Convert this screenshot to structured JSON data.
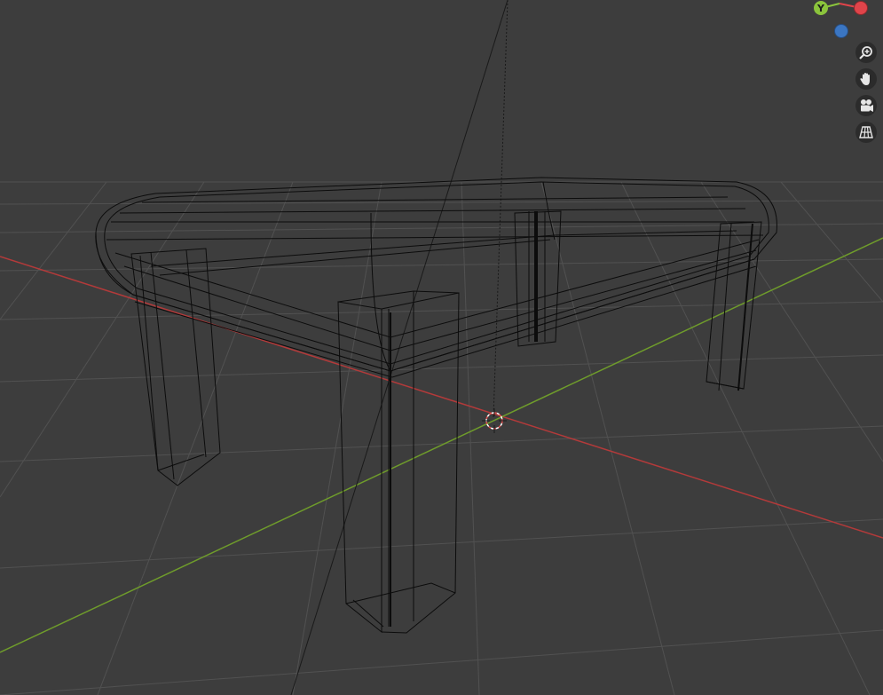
{
  "viewport": {
    "shading": "wireframe",
    "background_color": "#3d3d3d",
    "grid_color": "#545454",
    "x_axis_color": "#b33a3a",
    "y_axis_color": "#6f9c2b",
    "wire_color": "#0c0c0c"
  },
  "gizmo": {
    "y_label": "Y",
    "y_color": "#8bc43c",
    "x_color": "#e0444a",
    "z_color": "#3b76c2"
  },
  "nav_buttons": [
    {
      "name": "zoom-in-button",
      "icon": "zoom-in-icon"
    },
    {
      "name": "pan-button",
      "icon": "hand-icon"
    },
    {
      "name": "camera-view-button",
      "icon": "camera-icon"
    },
    {
      "name": "orthographic-toggle-button",
      "icon": "grid-icon"
    }
  ]
}
